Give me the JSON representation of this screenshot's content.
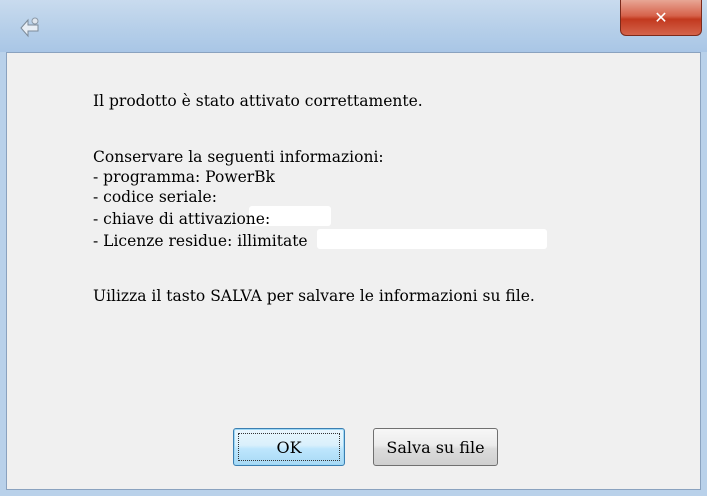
{
  "dialog": {
    "lines": {
      "success": "Il prodotto è stato attivato correttamente.",
      "keep": "Conservare la seguenti informazioni:",
      "program": "- programma: PowerBk",
      "serial": "- codice seriale:",
      "activation": "- chiave di attivazione:",
      "licenses": "- Licenze residue: illimitate",
      "hint": "Uilizza il tasto SALVA per salvare le informazioni su file."
    },
    "buttons": {
      "ok": "OK",
      "save": "Salva su file"
    },
    "titlebar": {
      "close": "✕"
    }
  },
  "icons": [
    "app-icon",
    "close-icon"
  ],
  "colors": {
    "frame": "#b9d1ea",
    "client": "#f0f0f0",
    "close": "#c2391f"
  }
}
